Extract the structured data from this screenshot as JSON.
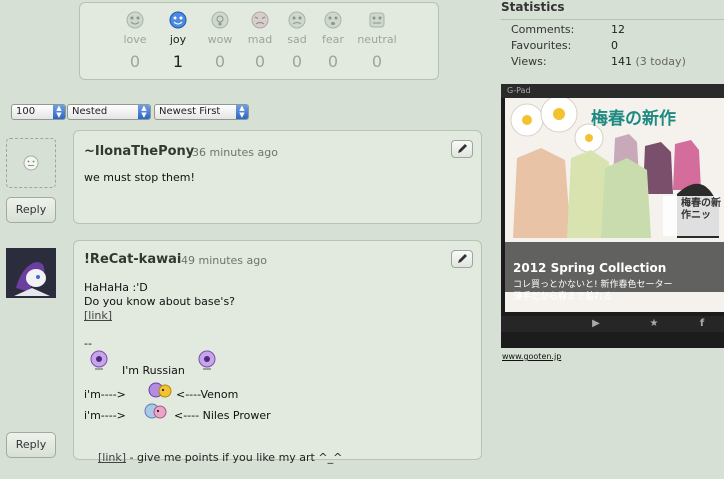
{
  "moods": [
    {
      "label": "love",
      "count": "0",
      "active": false
    },
    {
      "label": "joy",
      "count": "1",
      "active": true
    },
    {
      "label": "wow",
      "count": "0",
      "active": false
    },
    {
      "label": "mad",
      "count": "0",
      "active": false
    },
    {
      "label": "sad",
      "count": "0",
      "active": false
    },
    {
      "label": "fear",
      "count": "0",
      "active": false
    },
    {
      "label": "neutral",
      "count": "0",
      "active": false
    }
  ],
  "controls": {
    "per_page": "100",
    "view": "Nested",
    "sort": "Newest First"
  },
  "comments": [
    {
      "author": "~IlonaThePony",
      "time": "36 minutes ago",
      "text": "we must stop them!",
      "reply": "Reply"
    },
    {
      "author": "!ReCat-kawai",
      "time": "49 minutes ago",
      "line1": "HaHaHa :'D",
      "line2": "Do you know about base's?",
      "link1": "[link]",
      "dash": "--",
      "russian": "I'm Russian",
      "venom_left": "i'm---->",
      "venom_right": "<----Venom",
      "niles_left": "i'm---->",
      "niles_right": "<---- Niles Prower",
      "link2": "[link]",
      "tail": " - give me points if you like my art ^_^",
      "reply": "Reply"
    }
  ],
  "stats": {
    "title": "Statistics",
    "comments_label": "Comments:",
    "comments_val": "12",
    "fav_label": "Favourites:",
    "fav_val": "0",
    "views_label": "Views:",
    "views_val": "141",
    "views_today": "(3 today)"
  },
  "ad": {
    "device": "G-Pad",
    "headline": "梅春の新作",
    "headline_side": "梅春の新作ニッ",
    "caption": "2012 Spring Collection",
    "jp1": "コレ買っとかないと! 新作春色セーター",
    "jp2": "薄手だから春まで着れる",
    "url": "www.gooten.jp"
  },
  "colors": {
    "accent": "#2f66c6",
    "background": "#d7e0d4",
    "panel": "#e2e9df"
  }
}
